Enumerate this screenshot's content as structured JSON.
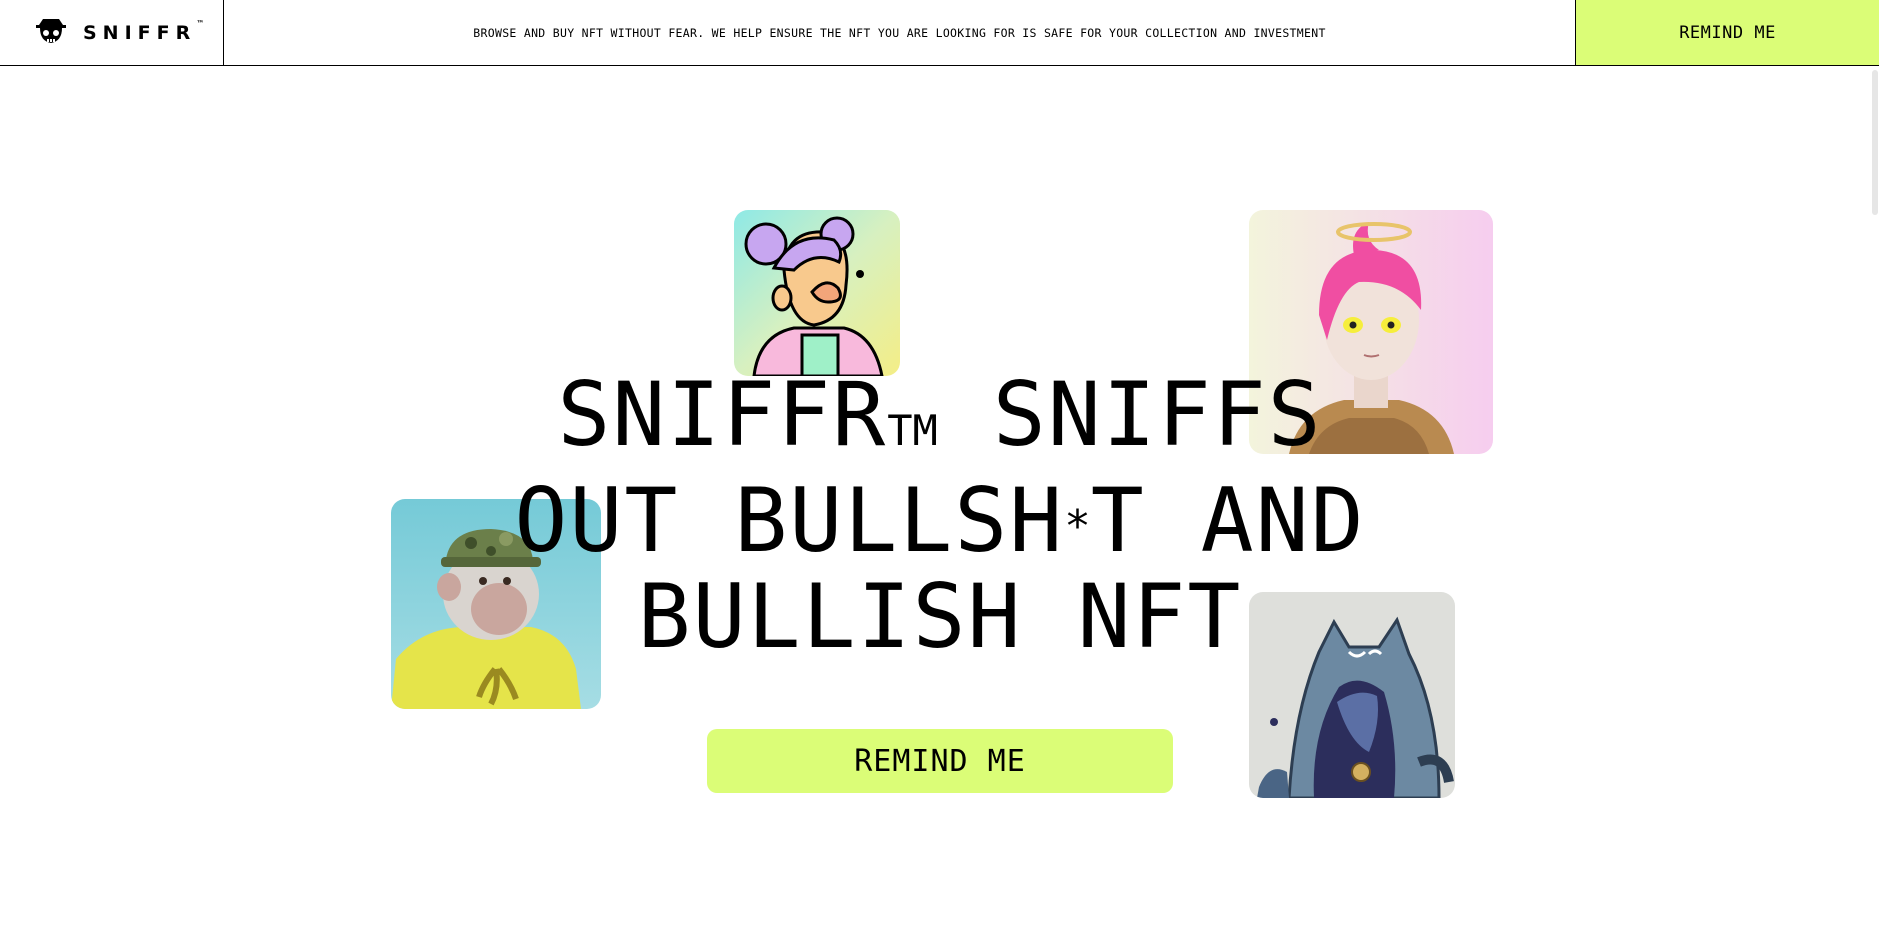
{
  "header": {
    "logo_text": "SNIFFR",
    "logo_tm": "™",
    "tagline": "BROWSE AND BUY NFT WITHOUT FEAR. WE HELP ENSURE THE NFT YOU ARE LOOKING FOR IS SAFE FOR YOUR COLLECTION AND INVESTMENT",
    "cta_label": "REMIND ME"
  },
  "hero": {
    "line1_a": "SNIFFR",
    "line1_tm": "TM",
    "line1_b": " SNIFFS",
    "line2_a": "OUT BULLSH",
    "line2_star": "*",
    "line2_b": "T AND",
    "line3": "BULLISH NFT",
    "cta_label": "REMIND ME"
  },
  "colors": {
    "accent": "#dbfd77",
    "text": "#000000",
    "background": "#ffffff"
  },
  "icons": {
    "logo": "masked-skull-icon"
  },
  "images": [
    {
      "name": "nft-cartoon-lilac-hair"
    },
    {
      "name": "nft-anime-pink-hair-halo"
    },
    {
      "name": "nft-ape-camo-hat"
    },
    {
      "name": "nft-cat-hood-girl"
    }
  ]
}
